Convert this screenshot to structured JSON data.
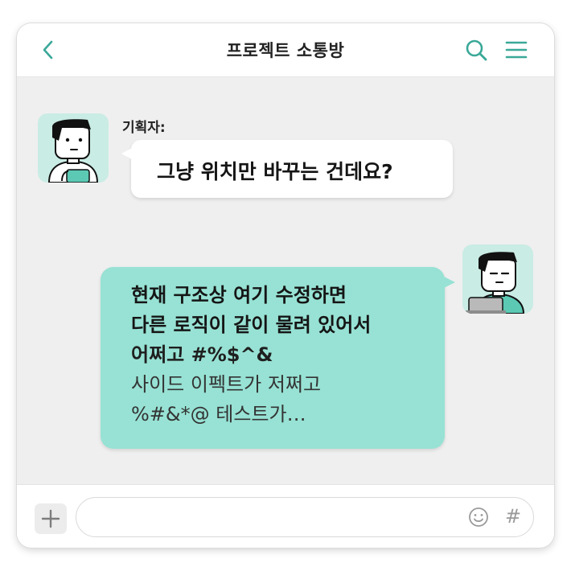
{
  "header": {
    "title": "프로젝트 소통방",
    "back_icon": "chevron-left-icon",
    "search_icon": "search-icon",
    "menu_icon": "hamburger-menu-icon",
    "accent_color": "#3aa898"
  },
  "messages": [
    {
      "sender": "기획자:",
      "side": "left",
      "text": "그냥 위치만 바꾸는 건데요?"
    },
    {
      "side": "right",
      "lines": [
        "현재 구조상 여기 수정하면",
        "다른 로직이 같이 물려 있어서",
        "어쩌고 #%$^&",
        "사이드 이펙트가 저쩌고",
        "%#&*@ 테스트가…"
      ],
      "bubble_color": "#97e2d4"
    }
  ],
  "input_bar": {
    "plus_icon": "plus-icon",
    "message_value": "",
    "emoji_icon": "emoji-smile-icon",
    "hash_label": "#"
  }
}
